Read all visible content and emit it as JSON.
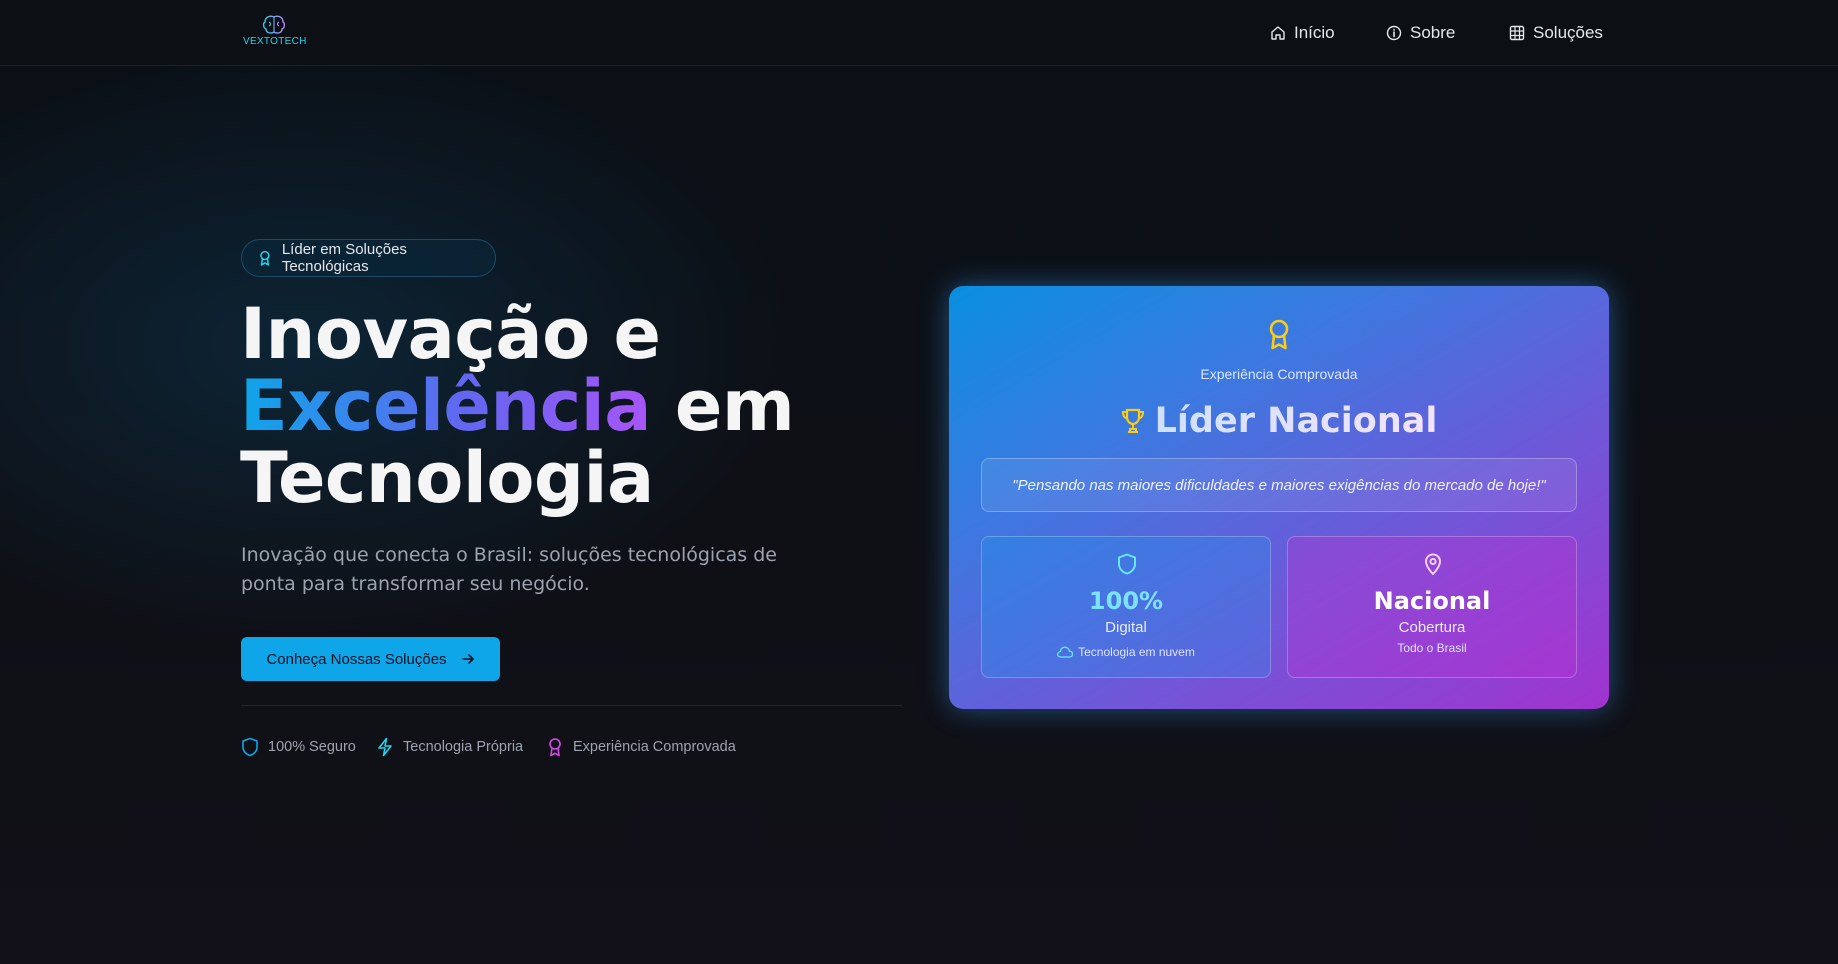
{
  "brand": {
    "name": "VEXTOTECH"
  },
  "nav": {
    "items": [
      {
        "label": "Início",
        "icon": "home-icon"
      },
      {
        "label": "Sobre",
        "icon": "info-icon"
      },
      {
        "label": "Soluções",
        "icon": "grid-icon"
      }
    ]
  },
  "hero": {
    "badge": "Líder em Soluções Tecnológicas",
    "headline": {
      "line1": "Inovação e",
      "highlight": "Excelência",
      "line2_rest": " em",
      "line3": "Tecnologia"
    },
    "subtitle": "Inovação que conecta o Brasil: soluções tecnológicas de ponta para transformar seu negócio.",
    "cta": "Conheça Nossas Soluções",
    "features": [
      {
        "label": "100% Seguro",
        "icon": "shield-icon"
      },
      {
        "label": "Tecnologia Própria",
        "icon": "bolt-icon"
      },
      {
        "label": "Experiência Comprovada",
        "icon": "award-icon"
      }
    ]
  },
  "card": {
    "eyebrow": "Experiência Comprovada",
    "title": "Líder Nacional",
    "quote": "\"Pensando nas maiores dificuldades e maiores exigências do mercado de hoje!\"",
    "stats": [
      {
        "value": "100%",
        "label": "Digital",
        "note": "Tecnologia em nuvem",
        "icon": "shield-icon",
        "note_icon": "cloud-icon"
      },
      {
        "value": "Nacional",
        "label": "Cobertura",
        "note": "Todo o Brasil",
        "icon": "map-pin-icon"
      }
    ]
  },
  "colors": {
    "accent": "#0ea5e9",
    "purple": "#a855f7",
    "magenta": "#d946ef",
    "gold": "#facc15",
    "background": "#0d0f14"
  }
}
